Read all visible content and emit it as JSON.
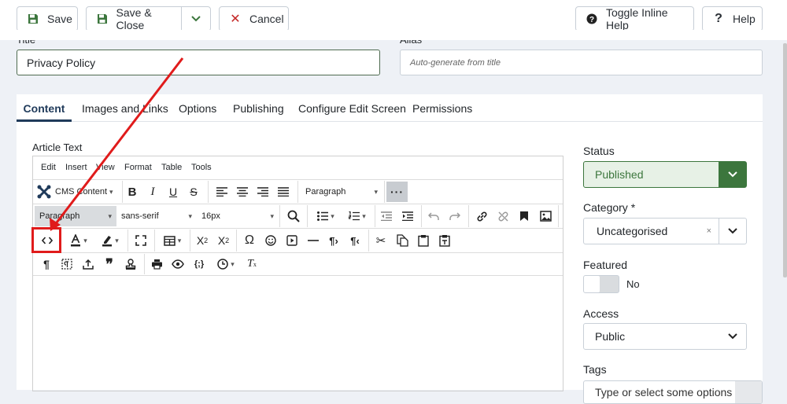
{
  "toolbar": {
    "save_label": "Save",
    "save_close_label": "Save & Close",
    "cancel_label": "Cancel",
    "toggle_help_label": "Toggle Inline Help",
    "help_label": "Help"
  },
  "fields": {
    "title_label": "Title",
    "title_value": "Privacy Policy",
    "alias_label": "Alias",
    "alias_placeholder": "Auto-generate from title"
  },
  "tabs": [
    "Content",
    "Images and Links",
    "Options",
    "Publishing",
    "Configure Edit Screen",
    "Permissions"
  ],
  "editor": {
    "label": "Article Text",
    "menu": [
      "Edit",
      "Insert",
      "View",
      "Format",
      "Table",
      "Tools"
    ],
    "cms_content": "CMS Content",
    "block_format_1": "Paragraph",
    "block_format_2": "Paragraph",
    "font_family": "sans-serif",
    "font_size": "16px"
  },
  "sidebar": {
    "status_label": "Status",
    "status_value": "Published",
    "category_label": "Category *",
    "category_value": "Uncategorised",
    "featured_label": "Featured",
    "featured_value": "No",
    "access_label": "Access",
    "access_value": "Public",
    "tags_label": "Tags",
    "tags_placeholder": "Type or select some options"
  },
  "colors": {
    "accent_green": "#3c763d",
    "status_bg": "#e7f1e6",
    "annotation_red": "#e01b1b",
    "tab_active": "#1f3a5a"
  }
}
